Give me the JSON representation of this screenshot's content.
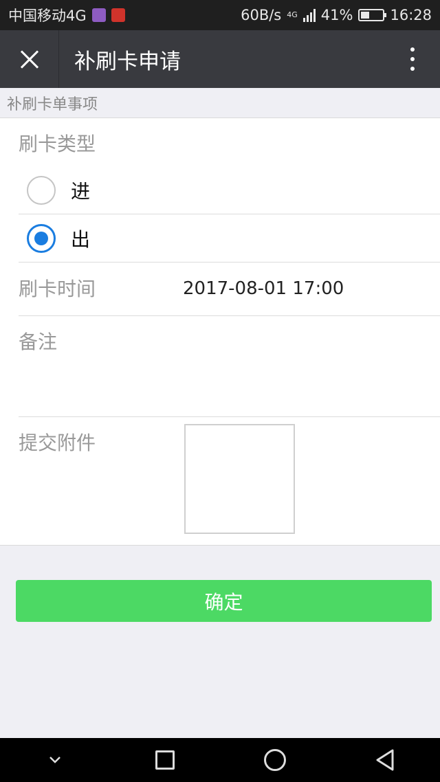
{
  "status_bar": {
    "carrier": "中国移动4G",
    "speed": "60B/s",
    "network": "4G",
    "battery": "41%",
    "battery_level": 0.41,
    "time": "16:28"
  },
  "title_bar": {
    "title": "补刷卡申请"
  },
  "section": {
    "header": "补刷卡单事项"
  },
  "form": {
    "card_type_label": "刷卡类型",
    "options": [
      {
        "label": "进",
        "selected": false
      },
      {
        "label": "出",
        "selected": true
      }
    ],
    "time_label": "刷卡时间",
    "time_value": "2017-08-01 17:00",
    "note_label": "备注",
    "attach_label": "提交附件"
  },
  "actions": {
    "confirm_label": "确定"
  },
  "icons": {
    "close": "close-icon",
    "more": "more-vertical-icon",
    "nav_back": "back-triangle-icon",
    "nav_home": "home-circle-icon",
    "nav_recent": "recent-square-icon",
    "nav_collapse": "chevron-down-icon"
  },
  "colors": {
    "title_bar_bg": "#393a3f",
    "radio_accent": "#1a7de0",
    "confirm_button": "#4cd964"
  }
}
